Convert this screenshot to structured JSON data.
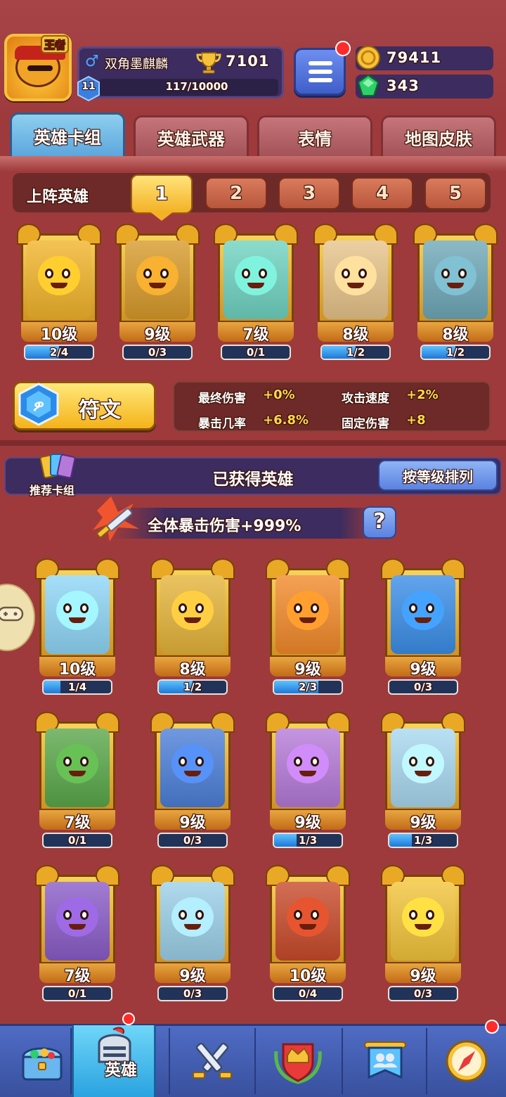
{
  "player": {
    "name": "双角墨麒麟",
    "crown_badge": "王者",
    "trophies": "7101",
    "level": "11",
    "xp": "117/10000"
  },
  "currency": {
    "gold": "79411",
    "gems": "343"
  },
  "tabs": [
    {
      "label": "英雄卡组"
    },
    {
      "label": "英雄武器"
    },
    {
      "label": "表情"
    },
    {
      "label": "地图皮肤"
    }
  ],
  "lineup": {
    "label": "上阵英雄",
    "slots": [
      "1",
      "2",
      "3",
      "4",
      "5"
    ],
    "active_slot": "1",
    "heroes": [
      {
        "level": "10级",
        "progress": "2/4",
        "fill": 0.5,
        "color": "#f2b42a"
      },
      {
        "level": "9级",
        "progress": "0/3",
        "fill": 0,
        "color": "#d89a2a"
      },
      {
        "level": "7级",
        "progress": "0/1",
        "fill": 0,
        "color": "#6fd3c1"
      },
      {
        "level": "8级",
        "progress": "1/2",
        "fill": 0.5,
        "color": "#e7c48a"
      },
      {
        "level": "8级",
        "progress": "1/2",
        "fill": 0.5,
        "color": "#6fa8b8"
      }
    ]
  },
  "rune": {
    "label": "符文"
  },
  "stats": {
    "final_damage_label": "最终伤害",
    "final_damage": "+0%",
    "attack_speed_label": "攻击速度",
    "attack_speed": "+2%",
    "crit_rate_label": "暴击几率",
    "crit_rate": "+6.8%",
    "fixed_damage_label": "固定伤害",
    "fixed_damage": "+8"
  },
  "obtained": {
    "deck_label": "推荐卡组",
    "title": "已获得英雄",
    "sort_label": "按等级排列",
    "bonus": "全体暴击伤害+999%",
    "help": "?",
    "heroes": [
      {
        "level": "10级",
        "progress": "1/4",
        "fill": 0.25,
        "color": "#8fd6f6"
      },
      {
        "level": "8级",
        "progress": "1/2",
        "fill": 0.5,
        "color": "#e5b43a"
      },
      {
        "level": "9级",
        "progress": "2/3",
        "fill": 0.66,
        "color": "#f28a2a"
      },
      {
        "level": "9级",
        "progress": "0/3",
        "fill": 0,
        "color": "#3b8ee8"
      },
      {
        "level": "7级",
        "progress": "0/1",
        "fill": 0,
        "color": "#5aa84a"
      },
      {
        "level": "9级",
        "progress": "0/3",
        "fill": 0,
        "color": "#4c7fd8"
      },
      {
        "level": "9级",
        "progress": "1/3",
        "fill": 0.33,
        "color": "#b57ad8"
      },
      {
        "level": "9级",
        "progress": "1/3",
        "fill": 0.33,
        "color": "#a8d8f0"
      },
      {
        "level": "7级",
        "progress": "0/1",
        "fill": 0,
        "color": "#8a5cc8"
      },
      {
        "level": "9级",
        "progress": "0/3",
        "fill": 0,
        "color": "#9cd0e8"
      },
      {
        "level": "10级",
        "progress": "0/4",
        "fill": 0,
        "color": "#c84a2a"
      },
      {
        "level": "9级",
        "progress": "0/3",
        "fill": 0,
        "color": "#f2c43a"
      }
    ]
  },
  "nav": {
    "items": [
      {
        "icon": "treasure-chest-icon"
      },
      {
        "icon": "knight-helmet-icon",
        "label": "英雄"
      },
      {
        "icon": "crossed-swords-icon"
      },
      {
        "icon": "crown-shield-icon"
      },
      {
        "icon": "team-banner-icon"
      },
      {
        "icon": "compass-icon"
      }
    ]
  }
}
